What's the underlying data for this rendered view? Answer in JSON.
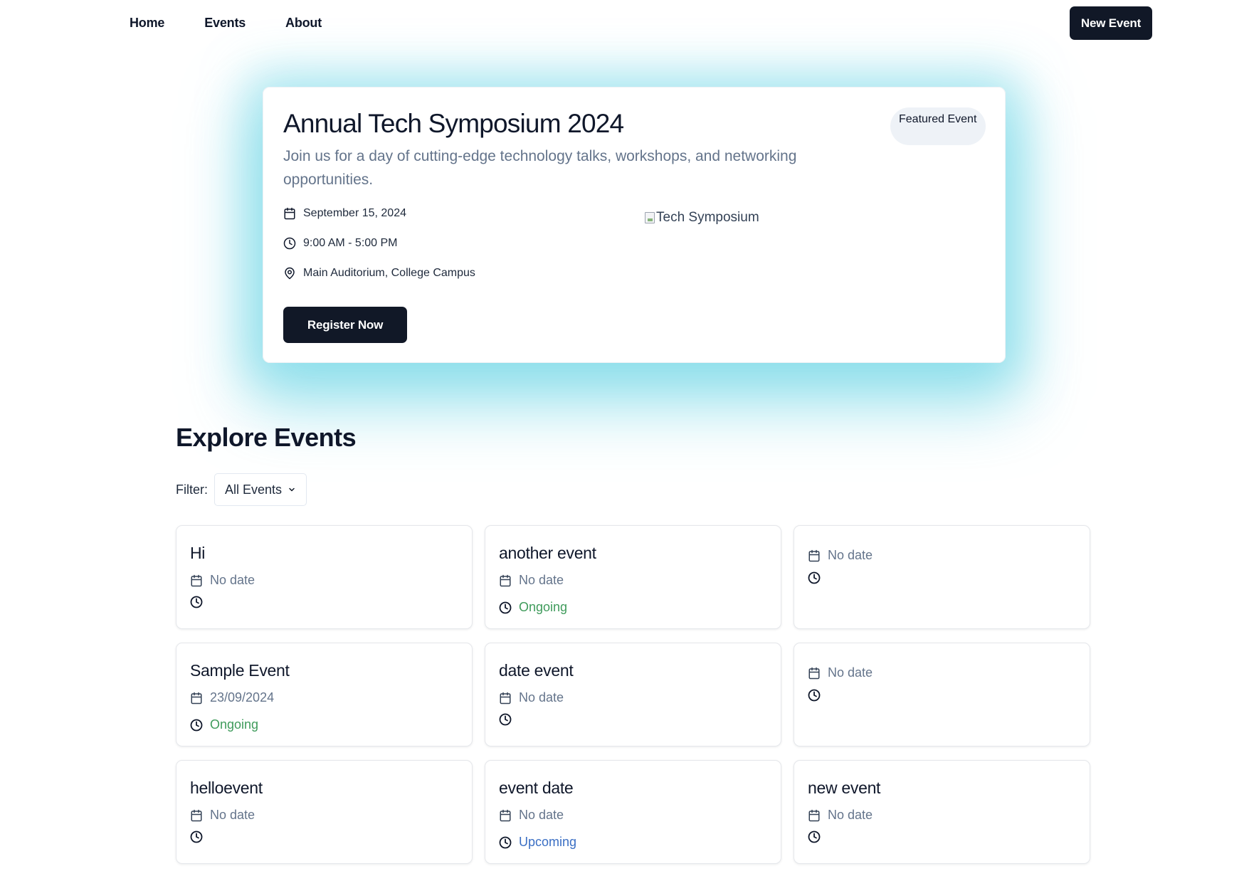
{
  "nav": {
    "links": [
      "Home",
      "Events",
      "About"
    ],
    "new_event_label": "New Event"
  },
  "hero": {
    "title": "Annual Tech Symposium 2024",
    "description": "Join us for a day of cutting-edge technology talks, workshops, and networking opportunities.",
    "badge": "Featured Event",
    "date": "September 15, 2024",
    "time": "9:00 AM - 5:00 PM",
    "location": "Main Auditorium, College Campus",
    "image_alt": "Tech Symposium",
    "register_label": "Register Now",
    "glow_color": "#67d3e4"
  },
  "explore": {
    "title": "Explore Events",
    "filter_label": "Filter:",
    "filter_value": "All Events"
  },
  "events": [
    {
      "title": "Hi",
      "date": "No date",
      "status": ""
    },
    {
      "title": "another event",
      "date": "No date",
      "status": "Ongoing"
    },
    {
      "title": "",
      "date": "No date",
      "status": ""
    },
    {
      "title": "Sample Event",
      "date": "23/09/2024",
      "status": "Ongoing"
    },
    {
      "title": "date event",
      "date": "No date",
      "status": ""
    },
    {
      "title": "",
      "date": "No date",
      "status": ""
    },
    {
      "title": "helloevent",
      "date": "No date",
      "status": ""
    },
    {
      "title": "event date",
      "date": "No date",
      "status": "Upcoming"
    },
    {
      "title": "new event",
      "date": "No date",
      "status": ""
    }
  ],
  "colors": {
    "primary_button": "#111827",
    "ongoing": "#3f9b5b",
    "upcoming": "#3b6fc4",
    "muted_text": "#64748b"
  }
}
